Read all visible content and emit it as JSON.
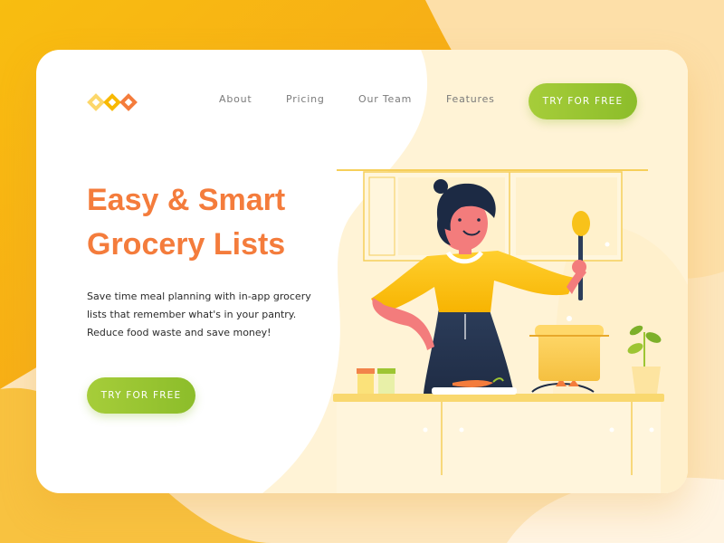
{
  "brand": {
    "colors": {
      "accent": "#f47c3c",
      "cta": "#9dc533",
      "yellow": "#f8b900",
      "cream": "#fff3d6"
    },
    "logo_icon": "three-diamonds-logo-icon"
  },
  "nav": {
    "items": [
      "About",
      "Pricing",
      "Our Team",
      "Features"
    ],
    "cta_label": "TRY FOR FREE"
  },
  "hero": {
    "title_line1": "Easy & Smart",
    "title_line2": "Grocery Lists",
    "description_lines": [
      "Save time meal planning with in-app grocery",
      "lists that remember what's in your pantry.",
      "Reduce food waste and save money!"
    ],
    "cta_label": "TRY FOR FREE"
  },
  "illustration": {
    "subject": "woman-cooking-in-kitchen-illustration"
  }
}
